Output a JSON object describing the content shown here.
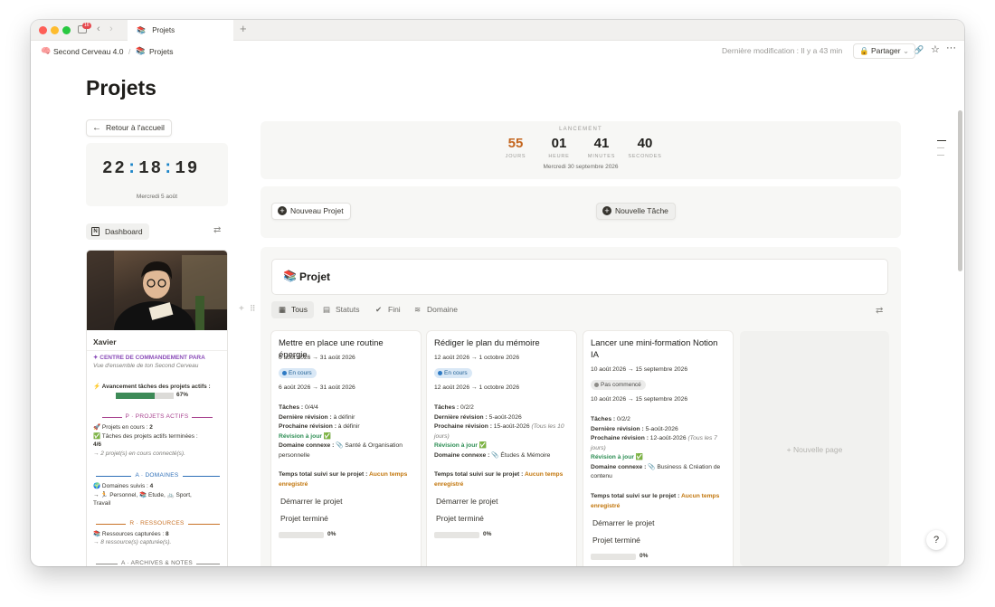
{
  "tab": {
    "title": "Projets",
    "badge": "16"
  },
  "header": {
    "workspace": "Second Cerveau 4.0",
    "separator": "/",
    "page": "Projets",
    "last_modified": "Dernière modification : Il y a 43 min",
    "share": "Partager"
  },
  "page": {
    "title": "Projets",
    "back_button": "Retour à l'accueil"
  },
  "clock": {
    "h": "22",
    "m": "18",
    "s": "19",
    "sep": ":",
    "date": "Mercredi 5 août"
  },
  "dashboard_button": "Dashboard",
  "profile": {
    "name": "Xavier",
    "command_title": "✦ CENTRE DE COMMANDEMENT PARA",
    "command_sub": "Vue d'ensemble de ton Second Cerveau",
    "progress_label": "⚡ Avancement tâches des projets actifs :",
    "progress_pct": "67%",
    "progress_value": 0.67,
    "p_title": "P · PROJETS ACTIFS",
    "p_line1": "🚀 Projets en cours : ",
    "p_line1_val": "2",
    "p_line2": "✅ Tâches des projets actifs terminées :",
    "p_line2_val": "4/6",
    "p_line3": "→ 2 projet(s) en cours connecté(s).",
    "a_title": "A · DOMAINES",
    "a_line1": "🌍 Domaines suivis : ",
    "a_line1_val": "4",
    "a_line2": "→ 🏃 Personnel, 📚 Etude, 🚲 Sport,",
    "a_line3": "Travail",
    "r_title": "R · RESSOURCES",
    "r_line1": "📚 Ressources capturées : ",
    "r_line1_val": "8",
    "r_line2": "→ 8 ressource(s) capturée(s).",
    "ar_title": "A · ARCHIVES & NOTES",
    "colors": {
      "purple": "#8b4db8",
      "magenta": "#a8428f",
      "blue": "#2e6fb8",
      "orange": "#c87227",
      "gray": "#8d8c88"
    }
  },
  "countdown": {
    "label": "LANCEMENT",
    "days": "55",
    "days_unit": "JOURS",
    "hours": "01",
    "hours_unit": "HEURE",
    "minutes": "41",
    "minutes_unit": "MINUTES",
    "seconds": "40",
    "seconds_unit": "SECONDES",
    "date": "Mercredi 30 septembre 2026"
  },
  "actions": {
    "new_project": "Nouveau Projet",
    "new_task": "Nouvelle Tâche"
  },
  "board": {
    "title": "Projet",
    "views": [
      "Tous",
      "Statuts",
      "Fini",
      "Domaine"
    ],
    "new_page": "Nouvelle page"
  },
  "labels": {
    "tasks": "Tâches : ",
    "last_review": "Dernière révision : ",
    "next_review": "Prochaine révision : ",
    "domain": "Domaine connexe : ",
    "time_tracked": "Temps total suivi sur le projet : ",
    "no_time": "Aucun temps enregistré",
    "start": "Démarrer le projet",
    "done": "Projet terminé"
  },
  "cards": [
    {
      "title": "Mettre en place une routine énergie",
      "dates": "6 août 2026 → 31 août 2026",
      "status": "En cours",
      "dates2": "6 août 2026 → 31 août 2026",
      "tasks": "0/4/4",
      "last": "à définir",
      "next": "à définir",
      "next_note": "",
      "revision": "Révision à jour ✅",
      "domain": "📎 Santé & Organisation personnelle",
      "progress": "0%",
      "progress_value": 0
    },
    {
      "title": "Rédiger le plan du mémoire",
      "dates": "12 août 2026 → 1 octobre 2026",
      "status": "En cours",
      "dates2": "12 août 2026 → 1 octobre 2026",
      "tasks": "0/2/2",
      "last": "5-août-2026",
      "next": "15-août-2026 ",
      "next_note": "(Tous les 10 jours)",
      "revision": "Révision à jour ✅",
      "domain": "📎 Études & Mémoire",
      "progress": "0%",
      "progress_value": 0
    },
    {
      "title": "Lancer une mini-formation Notion IA",
      "dates": "10 août 2026 → 15 septembre 2026",
      "status": "Pas commencé",
      "dates2": "10 août 2026 → 15 septembre 2026",
      "tasks": "0/2/2",
      "last": "5-août-2026",
      "next": "12-août-2026 ",
      "next_note": "(Tous les 7 jours)",
      "revision": "Révision à jour ✅",
      "domain": "📎 Business & Création de contenu",
      "progress": "0%",
      "progress_value": 0
    }
  ]
}
